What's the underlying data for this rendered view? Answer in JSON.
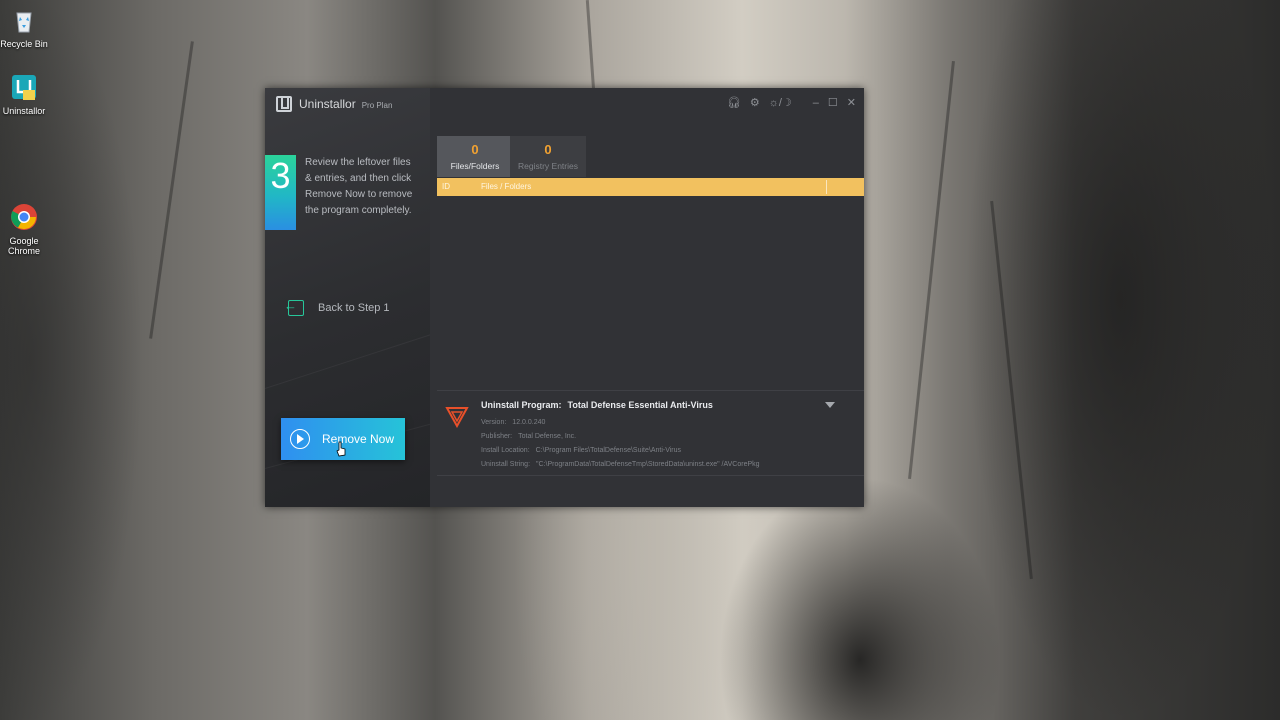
{
  "desktop": {
    "icons": [
      {
        "name": "recycle-bin",
        "label": "Recycle Bin"
      },
      {
        "name": "uninstallor",
        "label": "Uninstallor"
      },
      {
        "name": "google-chrome",
        "label": "Google Chrome"
      }
    ]
  },
  "app": {
    "name": "Uninstallor",
    "plan": "Pro Plan"
  },
  "sidebar": {
    "step_number": "3",
    "step_text": "Review the leftover files & entries, and then click Remove Now to remove the program completely.",
    "back_label": "Back to Step 1",
    "remove_label": "Remove Now"
  },
  "titlebar": {
    "icons": [
      "headset-icon",
      "gear-icon",
      "theme-toggle-icon",
      "minimize-icon",
      "maximize-icon",
      "close-icon"
    ]
  },
  "tabs": [
    {
      "count": "0",
      "label": "Files/Folders",
      "active": true
    },
    {
      "count": "0",
      "label": "Registry Entries",
      "active": false
    }
  ],
  "list": {
    "columns": [
      "ID",
      "Files / Folders"
    ],
    "rows": []
  },
  "program": {
    "title_label": "Uninstall Program:",
    "name": "Total Defense Essential Anti-Virus",
    "version_label": "Version:",
    "version": "12.0.0.240",
    "publisher_label": "Publisher:",
    "publisher": "Total Defense, Inc.",
    "location_label": "Install Location:",
    "location": "C:\\Program Files\\TotalDefense\\Suite\\Anti-Virus",
    "uninstall_label": "Uninstall String:",
    "uninstall_string": "\"C:\\ProgramData\\TotalDefenseTmp\\StoredData\\uninst.exe\" /AVCorePkg"
  },
  "colors": {
    "accent_orange": "#f2a231",
    "header_yellow": "#f2c15f",
    "button_blue": "#2f8ff0",
    "step_green": "#2bd39a"
  }
}
